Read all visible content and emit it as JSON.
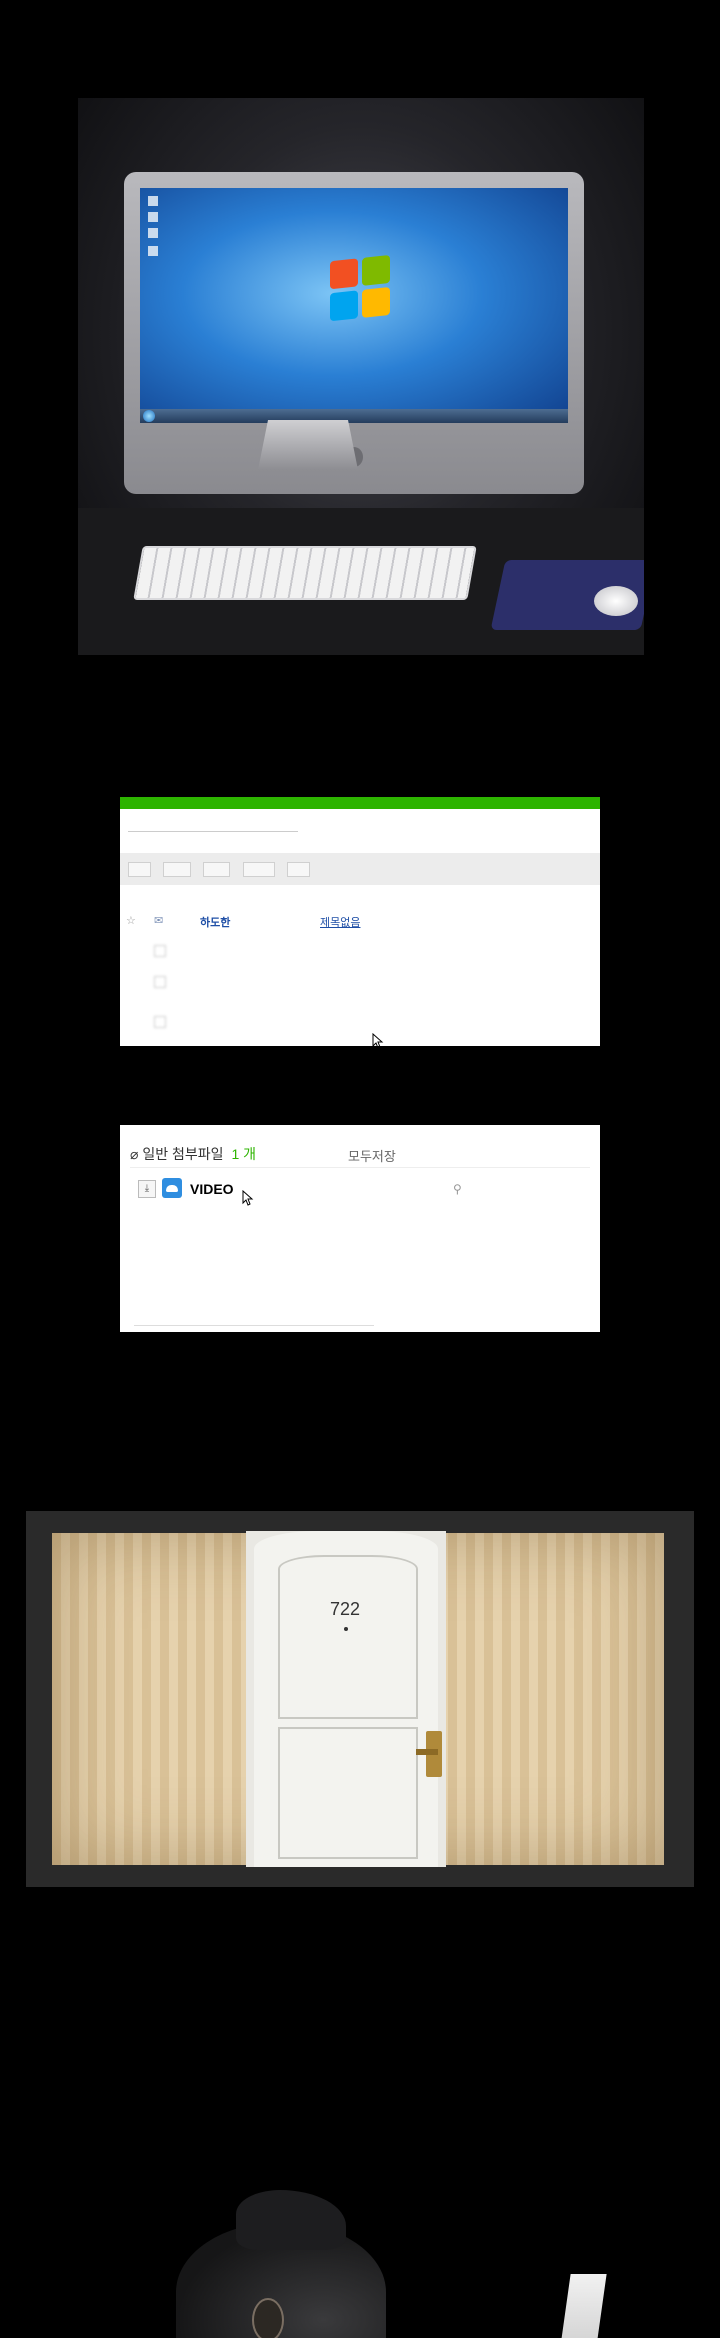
{
  "mail_list": {
    "rows": [
      {
        "sender": "하도한",
        "subject": "제목없음"
      }
    ]
  },
  "attachment": {
    "heading": "일반 첨부파일",
    "count": "1 개",
    "save_all": "모두저장",
    "file_name": "VIDEO"
  },
  "door": {
    "room_number": "722"
  },
  "colors": {
    "mail_green": "#2db400",
    "link_blue": "#1f4fa6",
    "cloud_blue": "#2f8ee0"
  }
}
